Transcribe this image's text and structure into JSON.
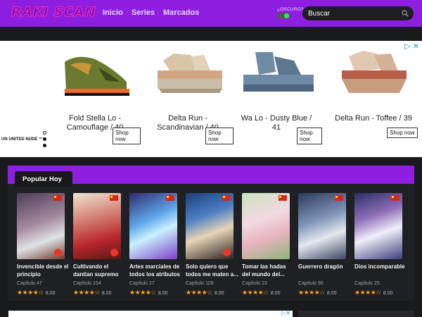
{
  "header": {
    "logo": "RAKI SCAN",
    "nav": [
      "Inicio",
      "Series",
      "Marcados"
    ],
    "dark_label": "¿OSCURO?",
    "search_placeholder": "Buscar"
  },
  "ad": {
    "brand": "UN UNITED NUDE ™",
    "close": "▷ ✕",
    "products": [
      {
        "name": "Fold Stella Lo - Camouflage / 40",
        "button": "Shop now"
      },
      {
        "name": "Delta Run - Scandinavian / 40",
        "button": "Shop now"
      },
      {
        "name": "Wa Lo - Dusty Blue / 41",
        "button": "Shop now"
      },
      {
        "name": "Delta Run - Toffee / 39",
        "button": "Shop now"
      }
    ]
  },
  "popular": {
    "title": "Popular Hoy",
    "items": [
      {
        "title": "Invencible desde el principio",
        "chapter": "Capítulo 47",
        "score": "8.00"
      },
      {
        "title": "Cultivando el dantian supremo",
        "chapter": "Capítulo 154",
        "score": "8.00"
      },
      {
        "title": "Artes marciales de todos los atributos",
        "chapter": "Capítulo 27",
        "score": "8.00"
      },
      {
        "title": "Solo quiero que todos me maten a...",
        "chapter": "Capítulo 109",
        "score": "8.00"
      },
      {
        "title": "Tomar las hadas del mundo del...",
        "chapter": "Capítulo 23",
        "score": "8.00"
      },
      {
        "title": "Guerrero dragón",
        "chapter": "Capítulo 90",
        "score": "8.00"
      },
      {
        "title": "Dios incomparable",
        "chapter": "Capítulo 25",
        "score": "8.00"
      }
    ]
  },
  "colors": {
    "accent": "#8e1fe0",
    "background": "#191a1c",
    "star": "#f5a623"
  }
}
